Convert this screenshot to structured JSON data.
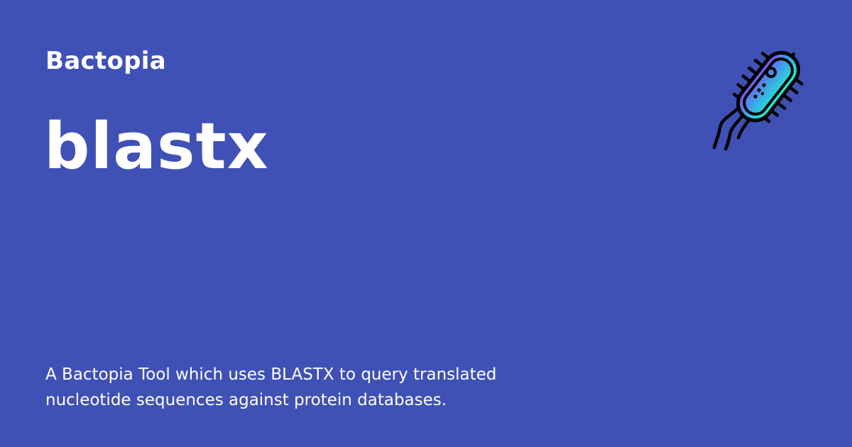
{
  "header": {
    "site_name": "Bactopia",
    "logo_icon": "bacterium-icon"
  },
  "main": {
    "title": "blastx",
    "description": "A Bactopia Tool which uses BLASTX to query translated nucleotide sequences against protein databases."
  },
  "colors": {
    "background": "#3f51b5",
    "text": "#ffffff",
    "logo_gradient_top": "#7b4ff0",
    "logo_gradient_bottom": "#22f0c8",
    "logo_outline": "#000000"
  }
}
